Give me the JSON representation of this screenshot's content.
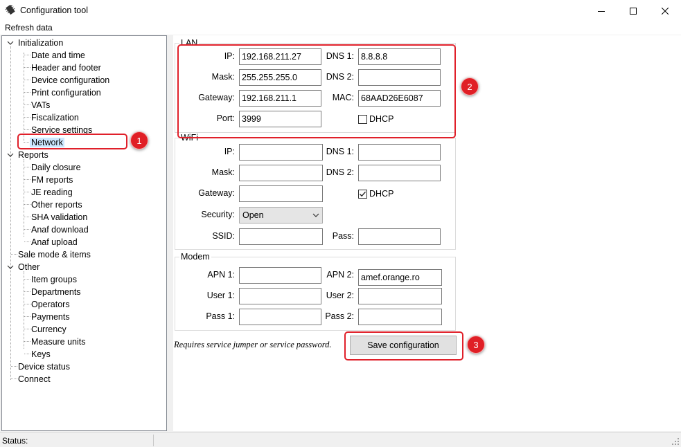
{
  "window": {
    "title": "Configuration tool",
    "app_icon": "chip-icon",
    "controls": [
      "minimize-icon",
      "maximize-icon",
      "close-icon"
    ]
  },
  "menu": {
    "refresh": "Refresh data"
  },
  "tree": {
    "initialization": {
      "label": "Initialization",
      "items": [
        "Date and time",
        "Header and footer",
        "Device configuration",
        "Print configuration",
        "VATs",
        "Fiscalization",
        "Service settings",
        "Network"
      ]
    },
    "reports": {
      "label": "Reports",
      "items": [
        "Daily closure",
        "FM reports",
        "JE reading",
        "Other reports",
        "SHA validation",
        "Anaf download",
        "Anaf upload"
      ]
    },
    "sale_mode": "Sale mode & items",
    "other": {
      "label": "Other",
      "items": [
        "Item groups",
        "Departments",
        "Operators",
        "Payments",
        "Currency",
        "Measure units",
        "Keys"
      ]
    },
    "device_status": "Device status",
    "connect": "Connect",
    "selected": "Network"
  },
  "lan": {
    "legend": "LAN",
    "ip_label": "IP:",
    "ip": "192.168.211.27",
    "mask_label": "Mask:",
    "mask": "255.255.255.0",
    "gateway_label": "Gateway:",
    "gateway": "192.168.211.1",
    "port_label": "Port:",
    "port": "3999",
    "dns1_label": "DNS 1:",
    "dns1": "8.8.8.8",
    "dns2_label": "DNS 2:",
    "dns2": "",
    "mac_label": "MAC:",
    "mac": "68AAD26E6087",
    "dhcp_label": "DHCP",
    "dhcp_checked": false
  },
  "wifi": {
    "legend": "WiFi",
    "ip_label": "IP:",
    "ip": "",
    "mask_label": "Mask:",
    "mask": "",
    "gateway_label": "Gateway:",
    "gateway": "",
    "security_label": "Security:",
    "security": "Open",
    "ssid_label": "SSID:",
    "ssid": "",
    "dns1_label": "DNS 1:",
    "dns1": "",
    "dns2_label": "DNS 2:",
    "dns2": "",
    "dhcp_label": "DHCP",
    "dhcp_checked": true,
    "pass_label": "Pass:",
    "pass": ""
  },
  "modem": {
    "legend": "Modem",
    "apn1_label": "APN 1:",
    "apn1": "",
    "user1_label": "User 1:",
    "user1": "",
    "pass1_label": "Pass 1:",
    "pass1": "",
    "apn2_label": "APN 2:",
    "apn2": "amef.orange.ro",
    "user2_label": "User 2:",
    "user2": "",
    "pass2_label": "Pass 2:",
    "pass2": ""
  },
  "note": "Requires service jumper or service password.",
  "save_button": "Save configuration",
  "callouts": [
    "1",
    "2",
    "3"
  ],
  "highlight_color": "#e0202a",
  "selection_color": "#cce8ff",
  "status": {
    "label": "Status:"
  }
}
